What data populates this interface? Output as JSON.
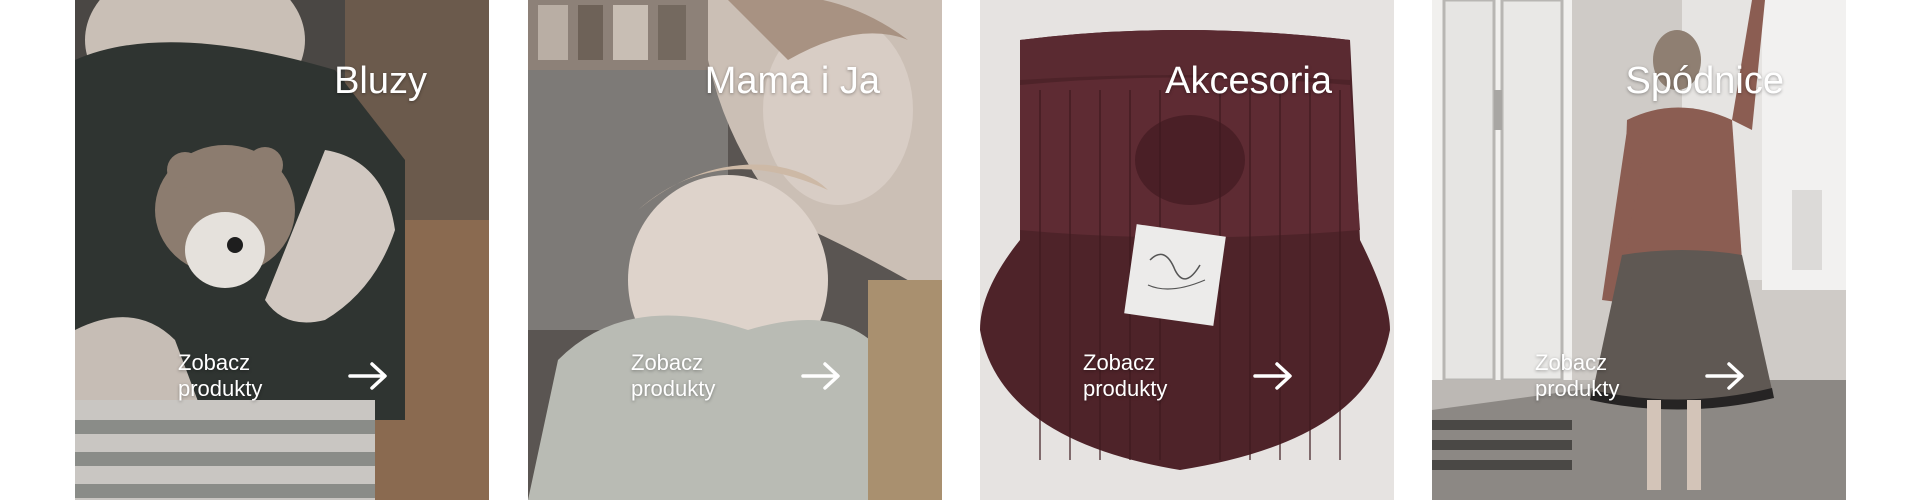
{
  "categories": [
    {
      "title": "Bluzy",
      "cta": "Zobacz produkty",
      "icon": "arrow-right-icon"
    },
    {
      "title": "Mama i Ja",
      "cta": "Zobacz produkty",
      "icon": "arrow-right-icon"
    },
    {
      "title": "Akcesoria",
      "cta": "Zobacz produkty",
      "icon": "arrow-right-icon"
    },
    {
      "title": "Spódnice",
      "cta": "Zobacz produkty",
      "icon": "arrow-right-icon"
    }
  ],
  "colors": {
    "text": "#ffffff",
    "page_background": "#ffffff"
  }
}
